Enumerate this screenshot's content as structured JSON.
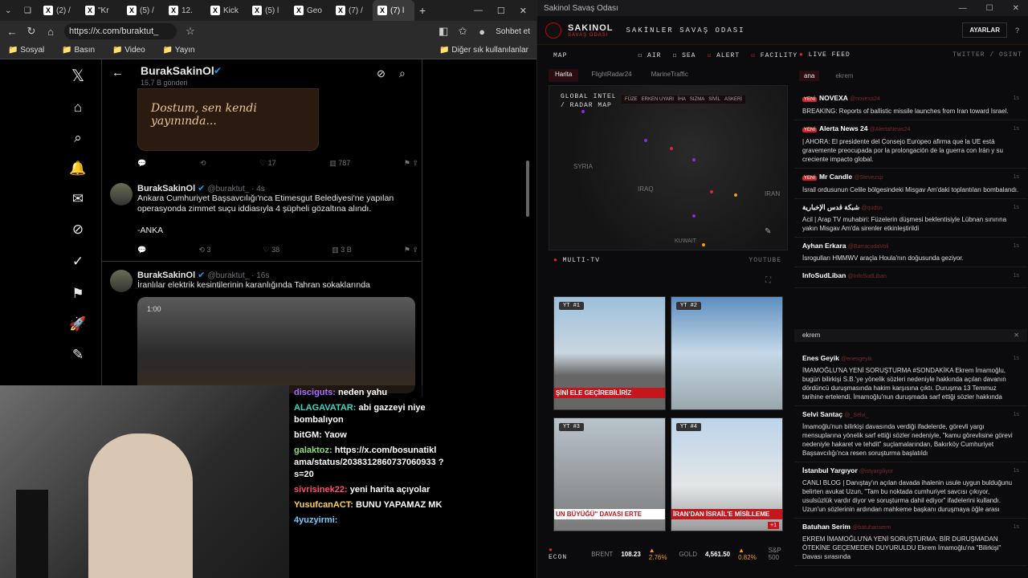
{
  "browser": {
    "tabs": [
      "(2) /",
      "\"Kr",
      "(5) /",
      "12.",
      "Kick",
      "(5) l",
      "Geo",
      "(7) /",
      "(7) l"
    ],
    "new_tab": "+",
    "url": "https://x.com/buraktut_",
    "chat_btn": "Sohbet et",
    "bookmarks": [
      "Sosyal",
      "Basın",
      "Video",
      "Yayın"
    ],
    "other_bookmarks": "Diğer sık kullanılanlar"
  },
  "x": {
    "profile_name": "BurakSakinOl",
    "post_count": "15,7 B gönderi",
    "top_image_text": "Dostum, sen kendi yayınında...",
    "top_stats": {
      "reply": "",
      "retweet": "",
      "like": "17",
      "views": "787"
    },
    "posts": [
      {
        "name": "BurakSakinOl",
        "handle": "@buraktut_ · 4s",
        "text": "Ankara Cumhuriyet Başsavcılığı'nca Etimesgut Belediyesi'ne yapılan operasyonda zimmet suçu iddiasıyla 4 şüpheli gözaltına alındı.",
        "source": "-ANKA",
        "retweet": "3",
        "like": "38",
        "views": "3 B"
      },
      {
        "name": "BurakSakinOl",
        "handle": "@buraktut_ · 16s",
        "text": "İranlılar elektrik kesintilerinin karanlığında Tahran sokaklarında",
        "video_time": "1:00"
      }
    ]
  },
  "chat": [
    {
      "user": "disciguts:",
      "msg": "neden yahu"
    },
    {
      "user": "ALAGAVATAR:",
      "msg": "abi gazzeyi niye bombalıyon"
    },
    {
      "user": "bitGM:",
      "msg": "Yaow"
    },
    {
      "user": "galaktoz:",
      "msg": "https://x.com/bosunatikl ama/status/2038312860737060933 ?s=20"
    },
    {
      "user": "sivrisinek22:",
      "msg": "yeni harita açıyolar"
    },
    {
      "user": "YusufcanACT:",
      "msg": "BUNU YAPAMAZ MK"
    },
    {
      "user": "4yuzyirmi:",
      "msg": ""
    }
  ],
  "app": {
    "window_title": "Sakinol Savaş Odası",
    "brand": "SAKINOL",
    "brand_sub": "SAVAŞ ODASI",
    "page_title": "SAKİNLER SAVAŞ ODASI",
    "settings": "AYARLAR",
    "help": "?",
    "map_label": "MAP",
    "filters": [
      "AIR",
      "SEA",
      "ALERT",
      "FACILITY"
    ],
    "live_label": "LIVE FEED",
    "live_src": "TWITTER / OSINT",
    "map_tabs": [
      "Harita",
      "FlightRadar24",
      "MarineTraffic"
    ],
    "map_title": "GLOBAL INTEL / RADAR MAP",
    "legend": [
      "FÜZE",
      "ERKEN UYARI",
      "İHA",
      "SIZMA",
      "SİVİL",
      "ASKERİ"
    ],
    "map_places": [
      "SYRIA",
      "IRAQ",
      "IRAN",
      "KUWAIT"
    ],
    "multitv": "MULTI-TV",
    "youtube": "YOUTUBE",
    "tv": [
      {
        "label": "YT #1",
        "caption": "ŞİNİ ELE GEÇİREBİLİRİZ"
      },
      {
        "label": "YT #2",
        "caption": ""
      },
      {
        "label": "YT #3",
        "caption": "UN BÜYÜĞÜ\" DAVASI ERTE"
      },
      {
        "label": "YT #4",
        "caption": "İRAN'DAN İSRAİL'E MİSİLLEME"
      }
    ],
    "tv_more": "+1",
    "econ": {
      "label": "ECON",
      "brent_l": "BRENT",
      "brent": "108.23",
      "brent_ch": "▲ 2.76%",
      "gold_l": "GOLD",
      "gold": "4,561.50",
      "gold_ch": "▲ 0.82%",
      "sp": "S&P 500"
    },
    "feed_tabs": [
      "ana",
      "ekrem"
    ],
    "feed1": [
      {
        "new": "YENİ",
        "name": "NOVEXA",
        "handle": "@novexa24",
        "text": "BREAKING: Reports of ballistic missile launches from Iran toward Israel.",
        "time": "1s"
      },
      {
        "new": "YENİ",
        "name": "Alerta News 24",
        "handle": "@AlertaNews24",
        "text": "| AHORA: El presidente del Consejo Europeo afirma que la UE está gravemente preocupada por la prolongación de la guerra con Irán y su creciente impacto global.",
        "time": "1s"
      },
      {
        "new": "YENİ",
        "name": "Mr Candle",
        "handle": "@Stevezsp",
        "text": "İsrail ordusunun Celile bölgesindeki Misgav Am'daki toplantıları bombalandı.",
        "time": "1s"
      },
      {
        "new": "",
        "name": "شبكة قدس الإخبارية",
        "handle": "@qudsn",
        "text": "Acil | Arap TV muhabiri: Füzelerin düşmesi beklentisiyle Lübnan sınırına yakın Misgav Am'da sirenler etkinleştirildi",
        "time": "1s"
      },
      {
        "new": "",
        "name": "Ayhan Erkara",
        "handle": "@BarracudaVoli",
        "text": "İsrogulları HMMWV araçla Houla'nın doğusunda geziyor.",
        "time": "1s"
      },
      {
        "new": "",
        "name": "InfoSudLiban",
        "handle": "@InfoSudLiban",
        "text": "",
        "time": "1s"
      }
    ],
    "feed2_title": "ekrem",
    "feed2": [
      {
        "name": "Enes Geyik",
        "handle": "@enesgeyik",
        "text": "İMAMOĞLU'NA YENİ SORUŞTURMA #SONDAKİKA Ekrem İmamoğlu, bugün bilirkişi S.B.'ye yönelik sözleri nedeniyle hakkında açılan davanın dördüncü duruşmasında hakim karşısına çıktı. Duruşma 13 Temmuz tarihine ertelendi. İmamoğlu'nun duruşmada sarf ettiği sözler hakkında",
        "time": "1s"
      },
      {
        "name": "Selvi Santaç",
        "handle": "@_Selvi_",
        "text": "İmamoğlu'nun bilirkişi davasında verdiği ifadelerde, görevli yargı mensuplarına yönelik sarf ettiği sözler nedeniyle, \"kamu görevlisine görevi nedeniyle hakaret ve tehdit\" suçlamalarından, Bakırköy Cumhuriyet Başsavcılığı'nca resen soruşturma başlatıldı",
        "time": "1s"
      },
      {
        "name": "İstanbul Yargıyor",
        "handle": "@istyargiliyor",
        "text": "CANLI BLOG | Danıştay'ın açılan davada ihalenin usule uygun bulduğunu belirten avukat Uzun, \"Tam bu noktada cumhuriyet savcısı çıkıyor, usulsüzlük vardır diyor ve soruşturma dahil ediyor\" ifadelerini kullandı. Uzun'un sözlerinin ardından mahkeme başkanı duruşmaya öğle arası",
        "time": "1s"
      },
      {
        "name": "Batuhan Serim",
        "handle": "@batuhanserm",
        "text": "EKREM İMAMOĞLU'NA YENİ SORUŞTURMA: BİR DURUŞMADAN ÖTEKİNE GEÇEMEDEN DUYURULDU Ekrem İmamoğlu'na \"Bilirkişi\" Davası sırasında",
        "time": "1s"
      }
    ]
  }
}
